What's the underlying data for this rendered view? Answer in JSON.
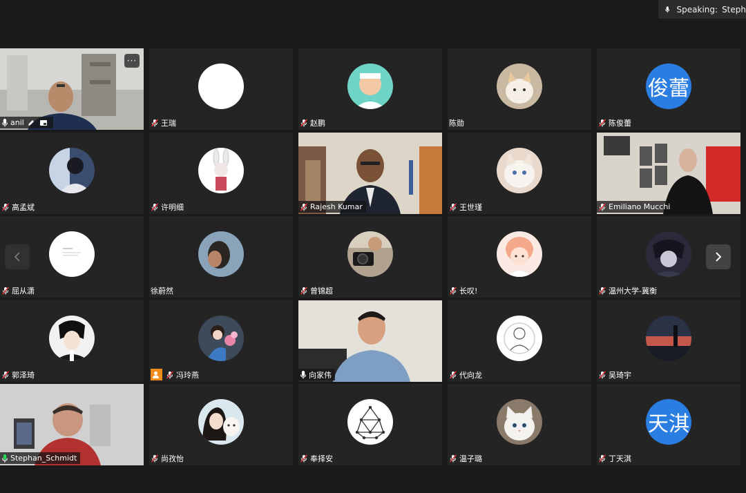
{
  "speaking_indicator": {
    "label": "Speaking:",
    "name": "Steph"
  },
  "controls": {
    "more_label": "···"
  },
  "participants": [
    {
      "name": "anil",
      "muted": false,
      "type": "video"
    },
    {
      "name": "王瑞",
      "muted": true,
      "type": "avatar"
    },
    {
      "name": "赵鹏",
      "muted": true,
      "type": "avatar"
    },
    {
      "name": "陈勋",
      "muted": false,
      "type": "avatar"
    },
    {
      "name": "陈俊蕾",
      "muted": true,
      "type": "avatar",
      "avatar_text": "俊蕾"
    },
    {
      "name": "高孟斌",
      "muted": true,
      "type": "avatar"
    },
    {
      "name": "许明细",
      "muted": true,
      "type": "avatar"
    },
    {
      "name": "Rajesh Kumar",
      "muted": true,
      "type": "video"
    },
    {
      "name": "王世瑾",
      "muted": true,
      "type": "avatar"
    },
    {
      "name": "Emiliano Mucchi",
      "muted": true,
      "type": "video"
    },
    {
      "name": "屈从潇",
      "muted": true,
      "type": "avatar"
    },
    {
      "name": "徐蔚然",
      "muted": false,
      "type": "avatar"
    },
    {
      "name": "曾锦超",
      "muted": true,
      "type": "avatar"
    },
    {
      "name": "长叹!",
      "muted": true,
      "type": "avatar"
    },
    {
      "name": "温州大学-冀衡",
      "muted": true,
      "type": "avatar"
    },
    {
      "name": "郭泽琦",
      "muted": true,
      "type": "avatar"
    },
    {
      "name": "冯玲燕",
      "muted": true,
      "type": "avatar",
      "host": true
    },
    {
      "name": "向家伟",
      "muted": false,
      "type": "video"
    },
    {
      "name": "代向龙",
      "muted": true,
      "type": "avatar"
    },
    {
      "name": "吴琦宇",
      "muted": true,
      "type": "avatar"
    },
    {
      "name": "Stephan_Schmidt",
      "muted": false,
      "type": "video",
      "active": true
    },
    {
      "name": "尚孜怡",
      "muted": true,
      "type": "avatar"
    },
    {
      "name": "奉择安",
      "muted": true,
      "type": "avatar"
    },
    {
      "name": "温子璐",
      "muted": true,
      "type": "avatar"
    },
    {
      "name": "丁天淇",
      "muted": true,
      "type": "avatar",
      "avatar_text": "天淇"
    }
  ],
  "colors": {
    "background": "#1a1a1a",
    "tile": "#242424",
    "active_border": "#23d959",
    "muted_mic": "#e0323a",
    "avatar_blue": "#2a7de1",
    "host_badge": "#f08c1a"
  }
}
